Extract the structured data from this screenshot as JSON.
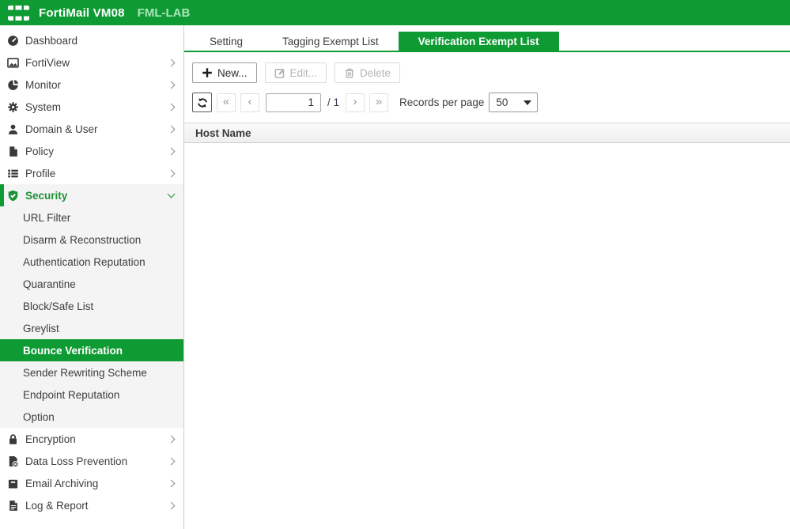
{
  "topbar": {
    "app_title": "FortiMail VM08",
    "environment": "FML-LAB"
  },
  "sidebar": {
    "items": [
      {
        "label": "Dashboard",
        "icon": "dashboard-icon"
      },
      {
        "label": "FortiView",
        "icon": "fortiview-icon",
        "chevron": "right"
      },
      {
        "label": "Monitor",
        "icon": "monitor-icon",
        "chevron": "right"
      },
      {
        "label": "System",
        "icon": "system-icon",
        "chevron": "right"
      },
      {
        "label": "Domain & User",
        "icon": "domain-user-icon",
        "chevron": "right"
      },
      {
        "label": "Policy",
        "icon": "policy-icon",
        "chevron": "right"
      },
      {
        "label": "Profile",
        "icon": "profile-icon",
        "chevron": "right"
      },
      {
        "label": "Security",
        "icon": "security-icon",
        "chevron": "down",
        "expanded": true,
        "children": [
          {
            "label": "URL Filter"
          },
          {
            "label": "Disarm & Reconstruction"
          },
          {
            "label": "Authentication Reputation"
          },
          {
            "label": "Quarantine"
          },
          {
            "label": "Block/Safe List"
          },
          {
            "label": "Greylist"
          },
          {
            "label": "Bounce Verification",
            "selected": true
          },
          {
            "label": "Sender Rewriting Scheme"
          },
          {
            "label": "Endpoint Reputation"
          },
          {
            "label": "Option"
          }
        ]
      },
      {
        "label": "Encryption",
        "icon": "encryption-icon",
        "chevron": "right"
      },
      {
        "label": "Data Loss Prevention",
        "icon": "dlp-icon",
        "chevron": "right"
      },
      {
        "label": "Email Archiving",
        "icon": "email-archiving-icon",
        "chevron": "right"
      },
      {
        "label": "Log & Report",
        "icon": "log-report-icon",
        "chevron": "right"
      }
    ]
  },
  "tabs": [
    {
      "label": "Setting"
    },
    {
      "label": "Tagging Exempt List"
    },
    {
      "label": "Verification Exempt List",
      "active": true
    }
  ],
  "toolbar": {
    "new": "New...",
    "edit": "Edit...",
    "delete": "Delete"
  },
  "pagination": {
    "first": "«",
    "prev": "‹",
    "next": "›",
    "last": "»",
    "current_page": "1",
    "page_separator": "/",
    "total_pages": "1",
    "records_per_page_label": "Records per page",
    "records_per_page": "50"
  },
  "table": {
    "columns": [
      "Host Name"
    ],
    "rows": []
  },
  "colors": {
    "brand_green": "#0f9b33",
    "selected_row_green": "#0f9b33",
    "environment_text": "#a9e4bc"
  }
}
